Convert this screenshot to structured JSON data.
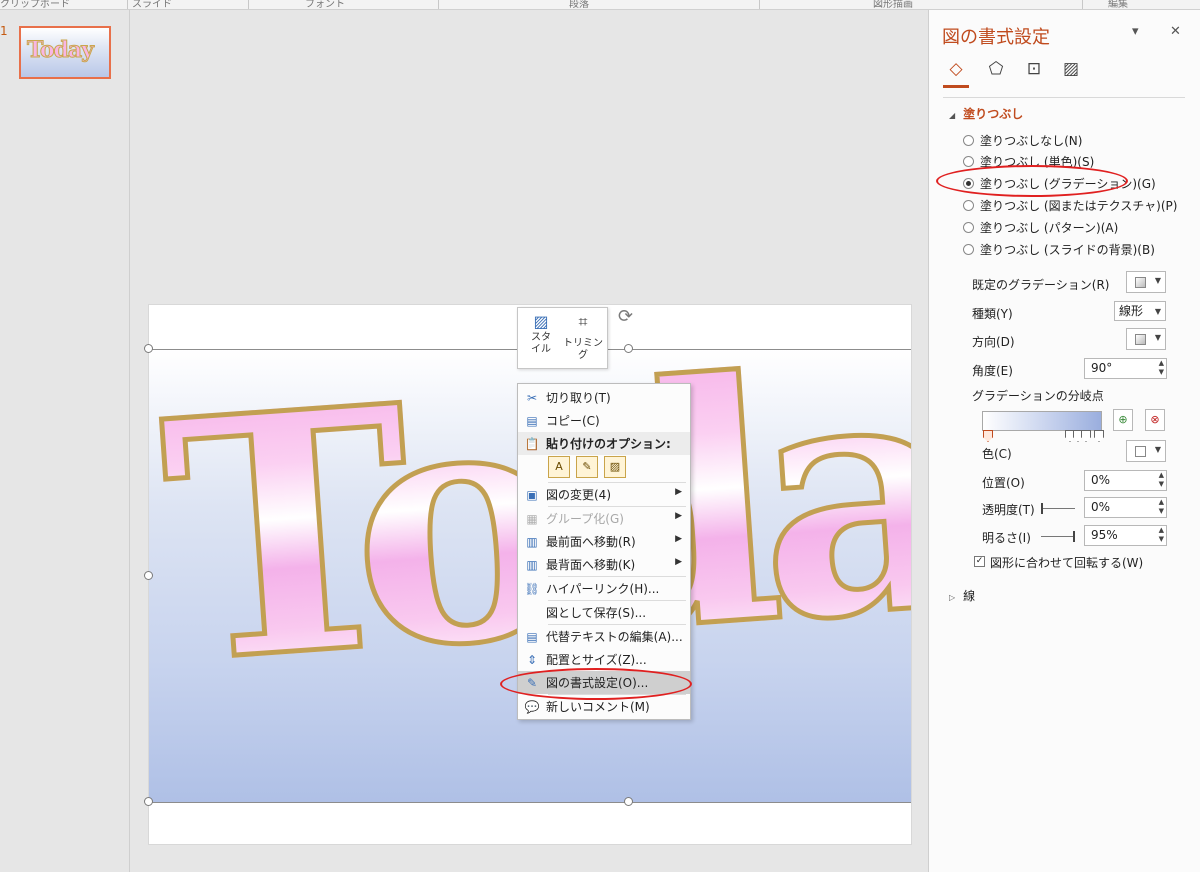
{
  "ribbon": {
    "groups": [
      {
        "label": "クリップボード"
      },
      {
        "label": "スライド"
      },
      {
        "label": "フォント"
      },
      {
        "label": "段落"
      },
      {
        "label": "図形描画"
      },
      {
        "label": "編集"
      }
    ]
  },
  "thumbnails": {
    "slide_number": "1",
    "thumb_text": "Today"
  },
  "slide": {
    "picture_text": "Today"
  },
  "mini_toolbar": {
    "style_label": "スタイル",
    "trim_label": "トリミング"
  },
  "context_menu": {
    "items": [
      {
        "icon": "✂",
        "label": "切り取り(T)",
        "state": "normal"
      },
      {
        "icon": "▤",
        "label": "コピー(C)",
        "state": "normal"
      },
      {
        "icon": "📋",
        "label": "貼り付けのオプション:",
        "state": "header"
      },
      {
        "icon": "▣",
        "label": "図の変更(4)",
        "state": "normal",
        "submenu": true
      },
      {
        "icon": "▦",
        "label": "グループ化(G)",
        "state": "disabled",
        "submenu": true
      },
      {
        "icon": "▥",
        "label": "最前面へ移動(R)",
        "state": "normal",
        "submenu": true
      },
      {
        "icon": "▥",
        "label": "最背面へ移動(K)",
        "state": "normal",
        "submenu": true
      },
      {
        "icon": "⛓",
        "label": "ハイパーリンク(H)...",
        "state": "normal"
      },
      {
        "icon": "",
        "label": "図として保存(S)...",
        "state": "normal"
      },
      {
        "icon": "▤",
        "label": "代替テキストの編集(A)...",
        "state": "normal"
      },
      {
        "icon": "⇕",
        "label": "配置とサイズ(Z)...",
        "state": "normal"
      },
      {
        "icon": "✎",
        "label": "図の書式設定(O)...",
        "state": "highlight"
      },
      {
        "icon": "💬",
        "label": "新しいコメント(M)",
        "state": "normal"
      }
    ],
    "paste_options": [
      "A",
      "✎",
      "▨"
    ]
  },
  "format_pane": {
    "title": "図の書式設定",
    "fill_section": "塗りつぶし",
    "fill_options": [
      {
        "label": "塗りつぶしなし(N)",
        "selected": false
      },
      {
        "label": "塗りつぶし (単色)(S)",
        "selected": false
      },
      {
        "label": "塗りつぶし (グラデーション)(G)",
        "selected": true
      },
      {
        "label": "塗りつぶし (図またはテクスチャ)(P)",
        "selected": false
      },
      {
        "label": "塗りつぶし (パターン)(A)",
        "selected": false
      },
      {
        "label": "塗りつぶし (スライドの背景)(B)",
        "selected": false
      }
    ],
    "preset_gradient_label": "既定のグラデーション(R)",
    "type_label": "種類(Y)",
    "type_value": "線形",
    "direction_label": "方向(D)",
    "angle_label": "角度(E)",
    "angle_value": "90°",
    "stops_label": "グラデーションの分岐点",
    "color_label": "色(C)",
    "position_label": "位置(O)",
    "position_value": "0%",
    "transparency_label": "透明度(T)",
    "transparency_value": "0%",
    "brightness_label": "明るさ(I)",
    "brightness_value": "95%",
    "rotate_label": "図形に合わせて回転する(W)",
    "rotate_checked": true,
    "line_section": "線"
  },
  "colors": {
    "accent": "#c04b1e",
    "annotation": "#e02020"
  }
}
